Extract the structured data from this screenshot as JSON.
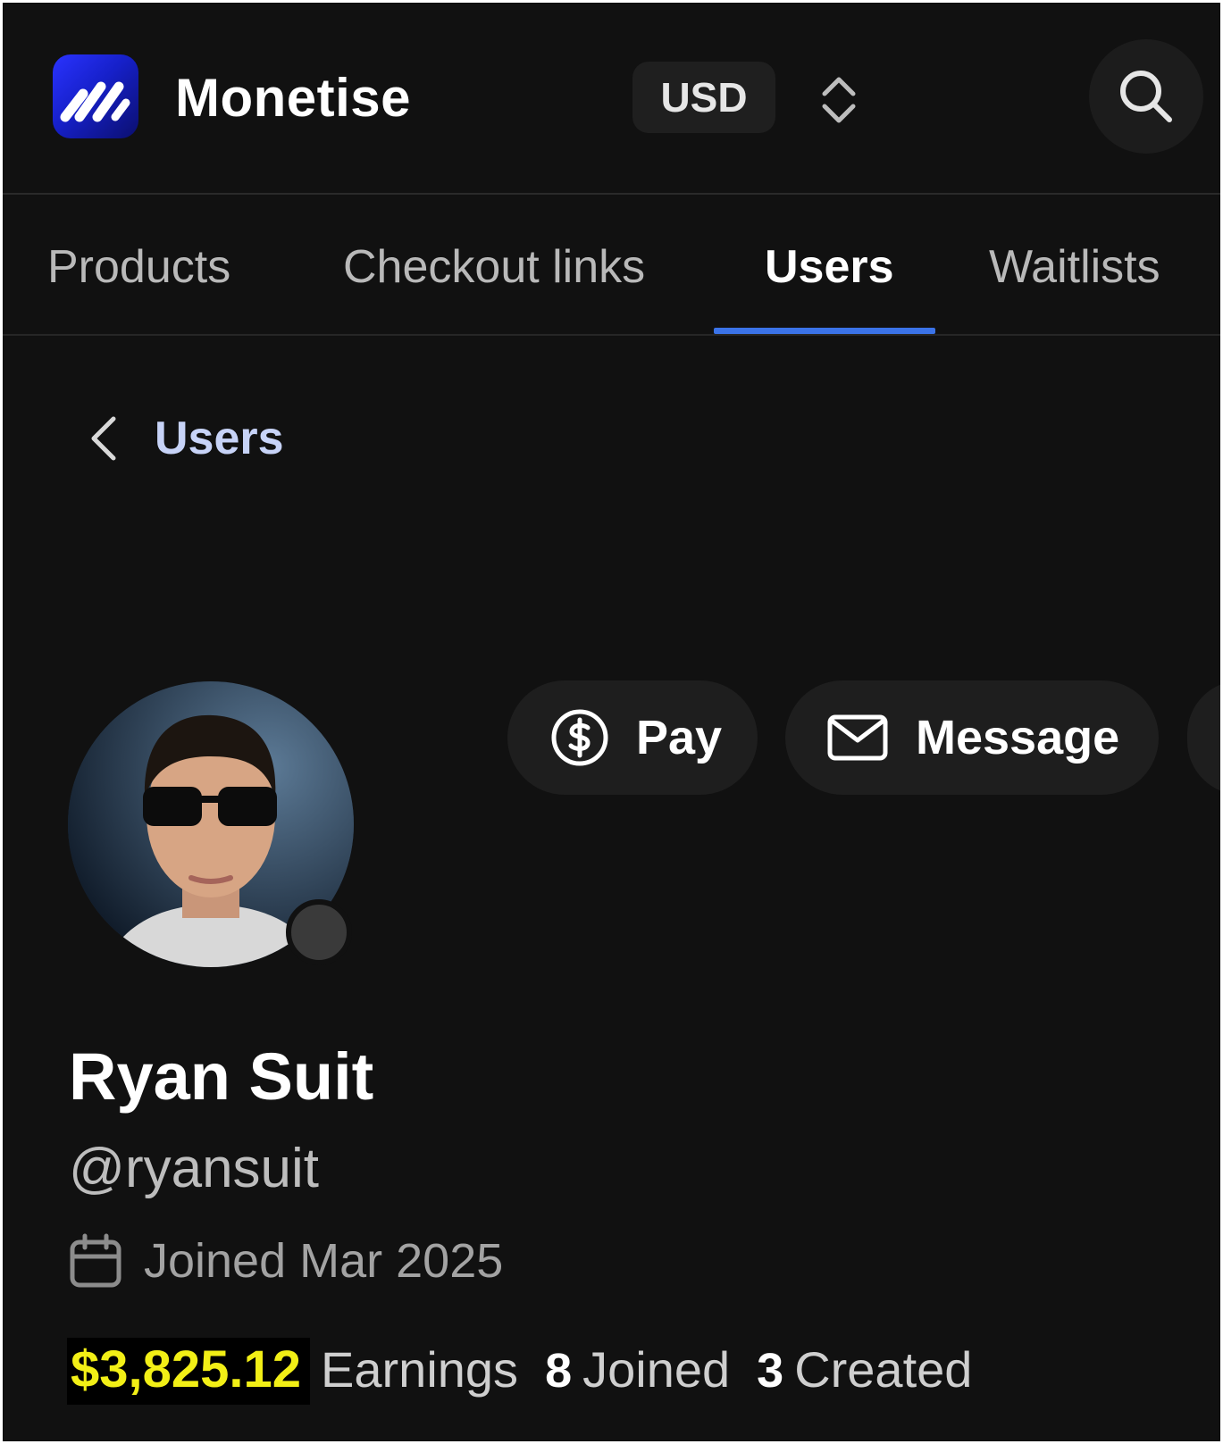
{
  "header": {
    "brand": "Monetise",
    "currency": "USD",
    "logo_icon": "monetise-logo-icon",
    "colors": {
      "logo_gradient_start": "#2a33ff",
      "logo_gradient_end": "#0b0f6e"
    }
  },
  "tabs": [
    {
      "label": "Products",
      "active": false
    },
    {
      "label": "Checkout links",
      "active": false
    },
    {
      "label": "Users",
      "active": true
    },
    {
      "label": "Waitlists",
      "active": false
    }
  ],
  "accent_color": "#3b73e8",
  "breadcrumb": {
    "back_label": "Users"
  },
  "actions": {
    "pay_label": "Pay",
    "message_label": "Message"
  },
  "profile": {
    "name": "Ryan Suit",
    "handle": "@ryansuit",
    "joined": "Joined Mar 2025",
    "earnings_value": "$3,825.12",
    "earnings_label": "Earnings",
    "joined_count": "8",
    "joined_label": "Joined",
    "created_count": "3",
    "created_label": "Created",
    "earnings_highlight_color": "#f2ef16"
  }
}
